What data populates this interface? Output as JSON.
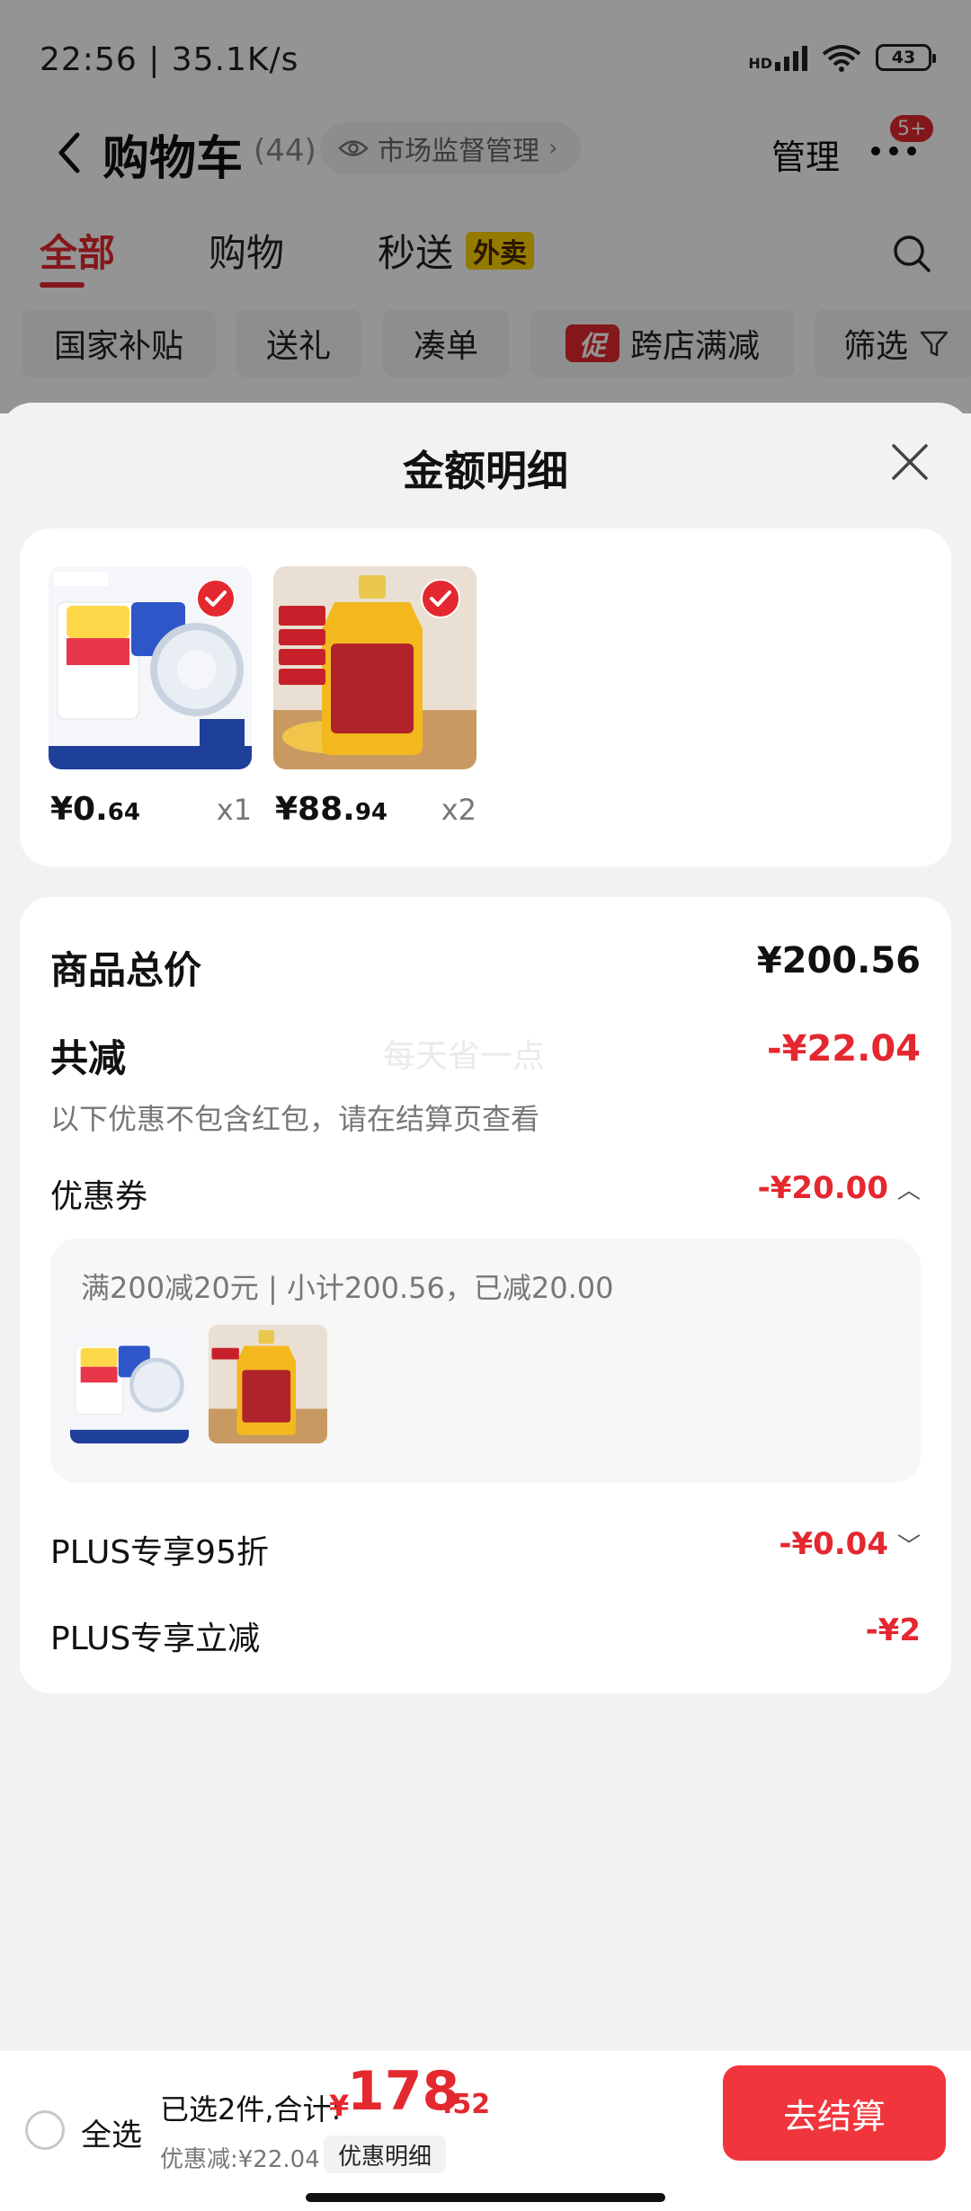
{
  "status_bar": {
    "time": "22:56 | 35.1K/s",
    "network": "HD",
    "battery": "43"
  },
  "nav": {
    "title": "购物车",
    "count": "(44)",
    "market_label": "市场监督管理",
    "manage_label": "管理",
    "more_badge": "5+"
  },
  "tabs": [
    {
      "label": "全部",
      "active": true
    },
    {
      "label": "购物",
      "active": false
    },
    {
      "label": "秒送",
      "active": false
    }
  ],
  "waimai_badge": "外卖",
  "chips": {
    "national_subsidy": "国家补贴",
    "gift": "送礼",
    "combine": "凑单",
    "promo_badge": "促",
    "cross_store": "跨店满减",
    "filter": "筛选"
  },
  "sheet": {
    "title": "金额明细",
    "products": [
      {
        "price_int": "¥0.",
        "price_dec": "64",
        "qty": "x1",
        "image": "tape-product-image"
      },
      {
        "price_int": "¥88.",
        "price_dec": "94",
        "qty": "x2",
        "image": "peanut-oil-product-image"
      }
    ],
    "summary": {
      "total_label": "商品总价",
      "total_value": "¥200.56",
      "reduce_label": "共减",
      "reduce_value": "-¥22.04",
      "reduce_hint": "以下优惠不包含红包，请在结算页查看",
      "watermark": "每天省一点",
      "coupon_label": "优惠券",
      "coupon_value": "-¥20.00",
      "coupon_detail": "满200减20元 | 小计200.56，已减20.00",
      "plus95_label": "PLUS专享95折",
      "plus95_value": "-¥0.04",
      "plusdirect_label": "PLUS专享立减",
      "plusdirect_value": "-¥2"
    }
  },
  "bottom_bar": {
    "select_all": "全选",
    "selected_text": "已选2件,合计:",
    "total_yen": "¥",
    "total_int": "178",
    "total_dec": ".52",
    "discount_text": "优惠减:¥22.04",
    "detail_button": "优惠明细",
    "checkout_button": "去结算"
  },
  "colors": {
    "accent": "#e4282f",
    "checkout": "#f0363c",
    "waimai": "#ffd400"
  }
}
